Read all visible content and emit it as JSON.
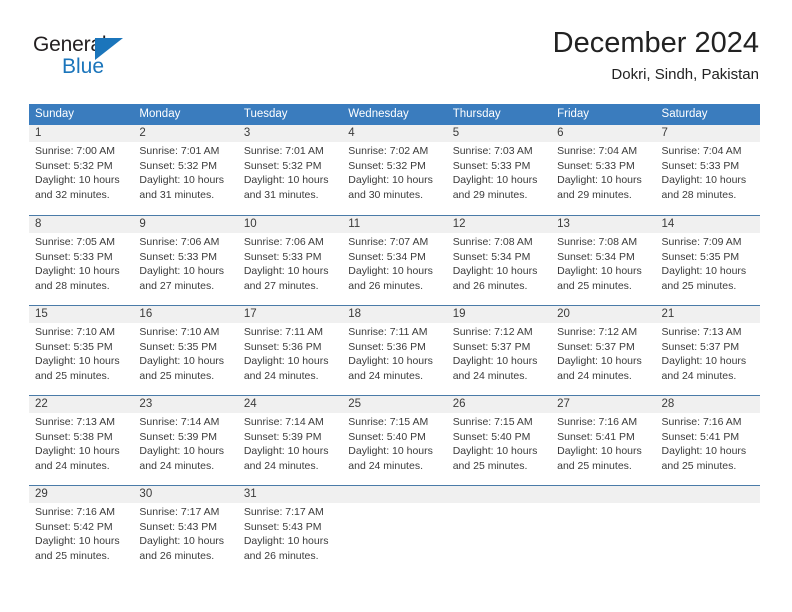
{
  "brand": {
    "name_part1": "General",
    "name_part2": "Blue",
    "triangle_color": "#1b75bb"
  },
  "header": {
    "title": "December 2024",
    "subtitle": "Dokri, Sindh, Pakistan"
  },
  "theme": {
    "header_blue": "#3a7cbe",
    "date_band_gray": "#f0f0f0",
    "row_line": "#4a7ba8",
    "text": "#3b3b3b"
  },
  "weekdays": [
    "Sunday",
    "Monday",
    "Tuesday",
    "Wednesday",
    "Thursday",
    "Friday",
    "Saturday"
  ],
  "weeks": [
    {
      "days": [
        {
          "num": "1",
          "sunrise": "Sunrise: 7:00 AM",
          "sunset": "Sunset: 5:32 PM",
          "daylight1": "Daylight: 10 hours",
          "daylight2": "and 32 minutes."
        },
        {
          "num": "2",
          "sunrise": "Sunrise: 7:01 AM",
          "sunset": "Sunset: 5:32 PM",
          "daylight1": "Daylight: 10 hours",
          "daylight2": "and 31 minutes."
        },
        {
          "num": "3",
          "sunrise": "Sunrise: 7:01 AM",
          "sunset": "Sunset: 5:32 PM",
          "daylight1": "Daylight: 10 hours",
          "daylight2": "and 31 minutes."
        },
        {
          "num": "4",
          "sunrise": "Sunrise: 7:02 AM",
          "sunset": "Sunset: 5:32 PM",
          "daylight1": "Daylight: 10 hours",
          "daylight2": "and 30 minutes."
        },
        {
          "num": "5",
          "sunrise": "Sunrise: 7:03 AM",
          "sunset": "Sunset: 5:33 PM",
          "daylight1": "Daylight: 10 hours",
          "daylight2": "and 29 minutes."
        },
        {
          "num": "6",
          "sunrise": "Sunrise: 7:04 AM",
          "sunset": "Sunset: 5:33 PM",
          "daylight1": "Daylight: 10 hours",
          "daylight2": "and 29 minutes."
        },
        {
          "num": "7",
          "sunrise": "Sunrise: 7:04 AM",
          "sunset": "Sunset: 5:33 PM",
          "daylight1": "Daylight: 10 hours",
          "daylight2": "and 28 minutes."
        }
      ]
    },
    {
      "days": [
        {
          "num": "8",
          "sunrise": "Sunrise: 7:05 AM",
          "sunset": "Sunset: 5:33 PM",
          "daylight1": "Daylight: 10 hours",
          "daylight2": "and 28 minutes."
        },
        {
          "num": "9",
          "sunrise": "Sunrise: 7:06 AM",
          "sunset": "Sunset: 5:33 PM",
          "daylight1": "Daylight: 10 hours",
          "daylight2": "and 27 minutes."
        },
        {
          "num": "10",
          "sunrise": "Sunrise: 7:06 AM",
          "sunset": "Sunset: 5:33 PM",
          "daylight1": "Daylight: 10 hours",
          "daylight2": "and 27 minutes."
        },
        {
          "num": "11",
          "sunrise": "Sunrise: 7:07 AM",
          "sunset": "Sunset: 5:34 PM",
          "daylight1": "Daylight: 10 hours",
          "daylight2": "and 26 minutes."
        },
        {
          "num": "12",
          "sunrise": "Sunrise: 7:08 AM",
          "sunset": "Sunset: 5:34 PM",
          "daylight1": "Daylight: 10 hours",
          "daylight2": "and 26 minutes."
        },
        {
          "num": "13",
          "sunrise": "Sunrise: 7:08 AM",
          "sunset": "Sunset: 5:34 PM",
          "daylight1": "Daylight: 10 hours",
          "daylight2": "and 25 minutes."
        },
        {
          "num": "14",
          "sunrise": "Sunrise: 7:09 AM",
          "sunset": "Sunset: 5:35 PM",
          "daylight1": "Daylight: 10 hours",
          "daylight2": "and 25 minutes."
        }
      ]
    },
    {
      "days": [
        {
          "num": "15",
          "sunrise": "Sunrise: 7:10 AM",
          "sunset": "Sunset: 5:35 PM",
          "daylight1": "Daylight: 10 hours",
          "daylight2": "and 25 minutes."
        },
        {
          "num": "16",
          "sunrise": "Sunrise: 7:10 AM",
          "sunset": "Sunset: 5:35 PM",
          "daylight1": "Daylight: 10 hours",
          "daylight2": "and 25 minutes."
        },
        {
          "num": "17",
          "sunrise": "Sunrise: 7:11 AM",
          "sunset": "Sunset: 5:36 PM",
          "daylight1": "Daylight: 10 hours",
          "daylight2": "and 24 minutes."
        },
        {
          "num": "18",
          "sunrise": "Sunrise: 7:11 AM",
          "sunset": "Sunset: 5:36 PM",
          "daylight1": "Daylight: 10 hours",
          "daylight2": "and 24 minutes."
        },
        {
          "num": "19",
          "sunrise": "Sunrise: 7:12 AM",
          "sunset": "Sunset: 5:37 PM",
          "daylight1": "Daylight: 10 hours",
          "daylight2": "and 24 minutes."
        },
        {
          "num": "20",
          "sunrise": "Sunrise: 7:12 AM",
          "sunset": "Sunset: 5:37 PM",
          "daylight1": "Daylight: 10 hours",
          "daylight2": "and 24 minutes."
        },
        {
          "num": "21",
          "sunrise": "Sunrise: 7:13 AM",
          "sunset": "Sunset: 5:37 PM",
          "daylight1": "Daylight: 10 hours",
          "daylight2": "and 24 minutes."
        }
      ]
    },
    {
      "days": [
        {
          "num": "22",
          "sunrise": "Sunrise: 7:13 AM",
          "sunset": "Sunset: 5:38 PM",
          "daylight1": "Daylight: 10 hours",
          "daylight2": "and 24 minutes."
        },
        {
          "num": "23",
          "sunrise": "Sunrise: 7:14 AM",
          "sunset": "Sunset: 5:39 PM",
          "daylight1": "Daylight: 10 hours",
          "daylight2": "and 24 minutes."
        },
        {
          "num": "24",
          "sunrise": "Sunrise: 7:14 AM",
          "sunset": "Sunset: 5:39 PM",
          "daylight1": "Daylight: 10 hours",
          "daylight2": "and 24 minutes."
        },
        {
          "num": "25",
          "sunrise": "Sunrise: 7:15 AM",
          "sunset": "Sunset: 5:40 PM",
          "daylight1": "Daylight: 10 hours",
          "daylight2": "and 24 minutes."
        },
        {
          "num": "26",
          "sunrise": "Sunrise: 7:15 AM",
          "sunset": "Sunset: 5:40 PM",
          "daylight1": "Daylight: 10 hours",
          "daylight2": "and 25 minutes."
        },
        {
          "num": "27",
          "sunrise": "Sunrise: 7:16 AM",
          "sunset": "Sunset: 5:41 PM",
          "daylight1": "Daylight: 10 hours",
          "daylight2": "and 25 minutes."
        },
        {
          "num": "28",
          "sunrise": "Sunrise: 7:16 AM",
          "sunset": "Sunset: 5:41 PM",
          "daylight1": "Daylight: 10 hours",
          "daylight2": "and 25 minutes."
        }
      ]
    },
    {
      "days": [
        {
          "num": "29",
          "sunrise": "Sunrise: 7:16 AM",
          "sunset": "Sunset: 5:42 PM",
          "daylight1": "Daylight: 10 hours",
          "daylight2": "and 25 minutes."
        },
        {
          "num": "30",
          "sunrise": "Sunrise: 7:17 AM",
          "sunset": "Sunset: 5:43 PM",
          "daylight1": "Daylight: 10 hours",
          "daylight2": "and 26 minutes."
        },
        {
          "num": "31",
          "sunrise": "Sunrise: 7:17 AM",
          "sunset": "Sunset: 5:43 PM",
          "daylight1": "Daylight: 10 hours",
          "daylight2": "and 26 minutes."
        },
        {
          "num": "",
          "sunrise": "",
          "sunset": "",
          "daylight1": "",
          "daylight2": ""
        },
        {
          "num": "",
          "sunrise": "",
          "sunset": "",
          "daylight1": "",
          "daylight2": ""
        },
        {
          "num": "",
          "sunrise": "",
          "sunset": "",
          "daylight1": "",
          "daylight2": ""
        },
        {
          "num": "",
          "sunrise": "",
          "sunset": "",
          "daylight1": "",
          "daylight2": ""
        }
      ]
    }
  ]
}
